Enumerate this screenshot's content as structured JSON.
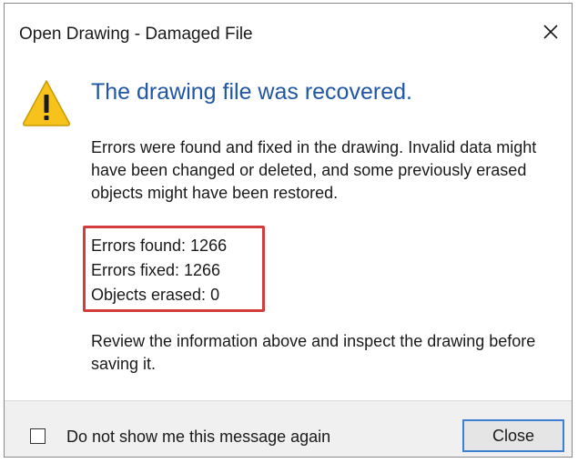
{
  "window": {
    "title": "Open Drawing - Damaged File"
  },
  "message": {
    "icon": "warning-triangle-icon",
    "heading": "The drawing file was recovered.",
    "paragraph1": "Errors were found and fixed in the drawing. Invalid data might have been changed or deleted, and some previously erased objects might have been restored.",
    "stats": [
      {
        "text": "Errors found:  1266"
      },
      {
        "text": "Errors fixed:  1266"
      },
      {
        "text": "Objects erased:  0"
      }
    ],
    "paragraph2": "Review the information above and inspect the drawing before saving it."
  },
  "footer": {
    "checkbox_label": "Do not show me this message again",
    "checkbox_checked": false,
    "close_label": "Close"
  },
  "colors": {
    "heading": "#1f56a5",
    "highlight_box": "#d33c3c",
    "warning_fill": "#f7c21b",
    "button_focus_border": "#3c7fd4"
  }
}
